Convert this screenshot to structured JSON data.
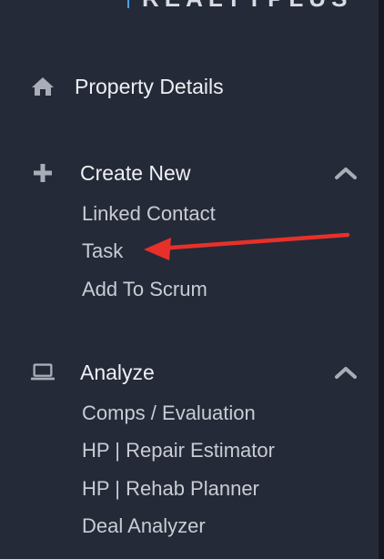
{
  "logo": {
    "text": "REALTYPLUS"
  },
  "nav": {
    "property_details": {
      "label": "Property Details",
      "icon": "home-icon"
    },
    "create_new": {
      "label": "Create New",
      "icon": "plus-icon",
      "expanded": true,
      "items": [
        "Linked Contact",
        "Task",
        "Add To Scrum"
      ]
    },
    "analyze": {
      "label": "Analyze",
      "icon": "laptop-icon",
      "expanded": true,
      "items": [
        "Comps / Evaluation",
        "HP | Repair Estimator",
        "HP | Rehab Planner",
        "Deal Analyzer"
      ]
    }
  },
  "colors": {
    "background": "#252a38",
    "text": "#eef0f4",
    "subtext": "#c9ccd4",
    "icon": "#a9adb8",
    "annotation": "#e8302a",
    "logo_accent": "#4aa3df"
  }
}
